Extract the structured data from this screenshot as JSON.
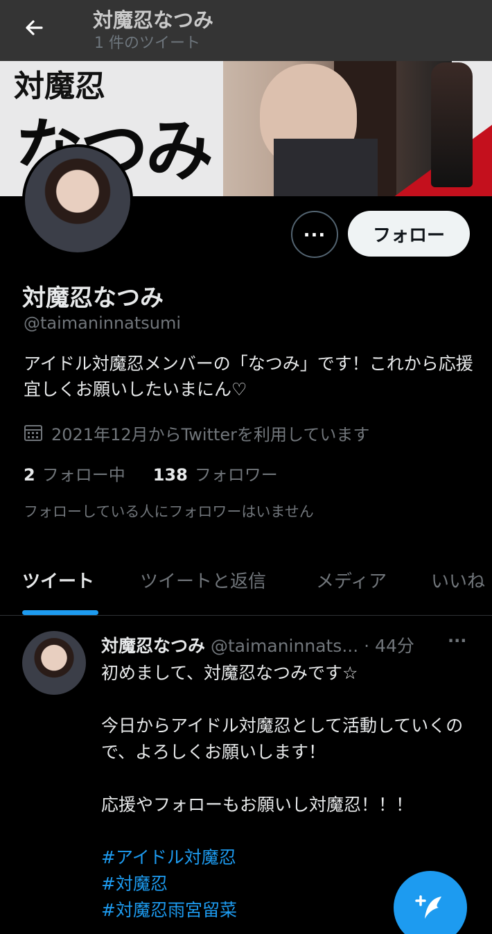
{
  "header": {
    "title": "対魔忍なつみ",
    "subtitle": "1 件のツイート"
  },
  "banner": {
    "text_small": "対魔忍",
    "text_big": "なつみ"
  },
  "profile": {
    "name": "対魔忍なつみ",
    "handle": "@taimaninnatsumi",
    "bio": "アイドル対魔忍メンバーの「なつみ」です！これから応援宜しくお願いしたいまにん♡",
    "joined": "2021年12月からTwitterを利用しています",
    "following_count": "2",
    "following_label": "フォロー中",
    "followers_count": "138",
    "followers_label": "フォロワー",
    "no_mutual": "フォローしている人にフォロワーはいません"
  },
  "actions": {
    "follow_label": "フォロー",
    "more_label": "..."
  },
  "tabs": [
    {
      "label": "ツイート",
      "active": true
    },
    {
      "label": "ツイートと返信",
      "active": false
    },
    {
      "label": "メディア",
      "active": false
    },
    {
      "label": "いいね",
      "active": false
    }
  ],
  "tweet": {
    "name": "対魔忍なつみ",
    "handle": "@taimaninnats...",
    "time": "· 44分",
    "more": "···",
    "line1": "初めまして、対魔忍なつみです☆",
    "line2": "今日からアイドル対魔忍として活動していくので、よろしくお願いします！",
    "line3": "応援やフォローもお願いし対魔忍！！！",
    "hashtags": [
      "#アイドル対魔忍",
      "#対魔忍",
      "#対魔忍雨宮留菜"
    ]
  },
  "colors": {
    "accent": "#1d9bf0",
    "background": "#000000",
    "muted": "#71767b"
  }
}
